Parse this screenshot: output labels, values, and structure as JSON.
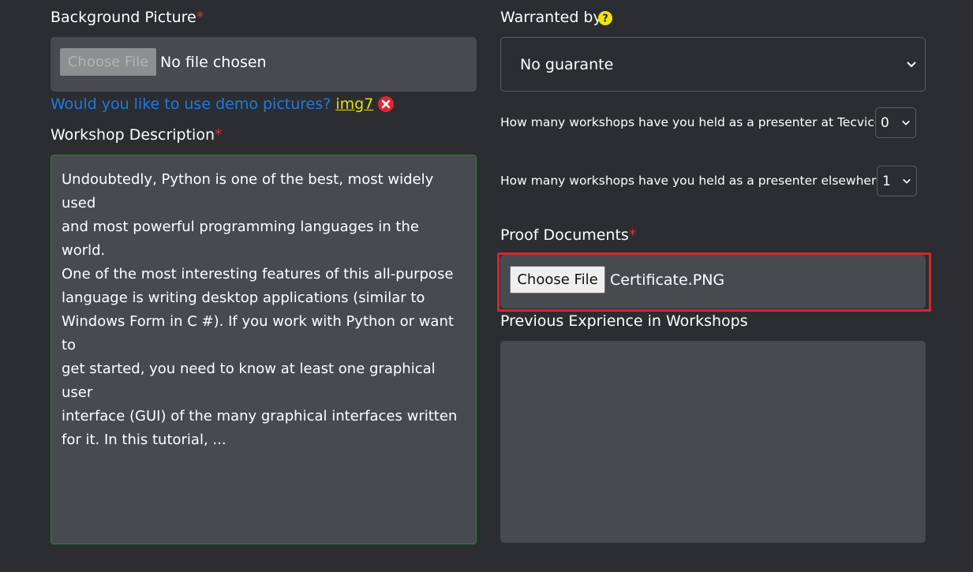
{
  "background_picture": {
    "label": "Background Picture",
    "required_mark": "*",
    "button_label": "Choose File",
    "file_status": "No file chosen"
  },
  "demo": {
    "question": "Would you like to use demo pictures?",
    "link": "img7"
  },
  "workshop_description": {
    "label": "Workshop Description",
    "required_mark": "*",
    "text": "Undoubtedly, Python is one of the best, most widely used\nand most powerful programming languages in the world.\nOne of the most interesting features of this all-purpose\nlanguage is writing desktop applications (similar to\nWindows Form in C #). If you work with Python or want to\nget started, you need to know at least one graphical user\ninterface (GUI) of the many graphical interfaces written\nfor it. In this tutorial, ..."
  },
  "warranted_by": {
    "label": "Warranted by",
    "selected": "No guarante"
  },
  "questions": {
    "tecvico_label": "How many workshops have you held as a presenter at Tecvico?",
    "tecvico_value": "0",
    "elsewhere_label": "How many workshops have you held as a presenter elsewhere?",
    "elsewhere_value": "1"
  },
  "proof_documents": {
    "label": "Proof Documents",
    "required_mark": "*",
    "button_label": "Choose File",
    "file_name": "Certificate.PNG"
  },
  "previous_experience": {
    "label": "Previous Exprience in Workshops",
    "text": ""
  },
  "colors": {
    "background": "#2b2d31",
    "field": "#474a4f",
    "required": "#e0303a",
    "link_blue": "#1f7ae0",
    "link_yellow": "#e8e000",
    "highlight": "#d3262e"
  }
}
